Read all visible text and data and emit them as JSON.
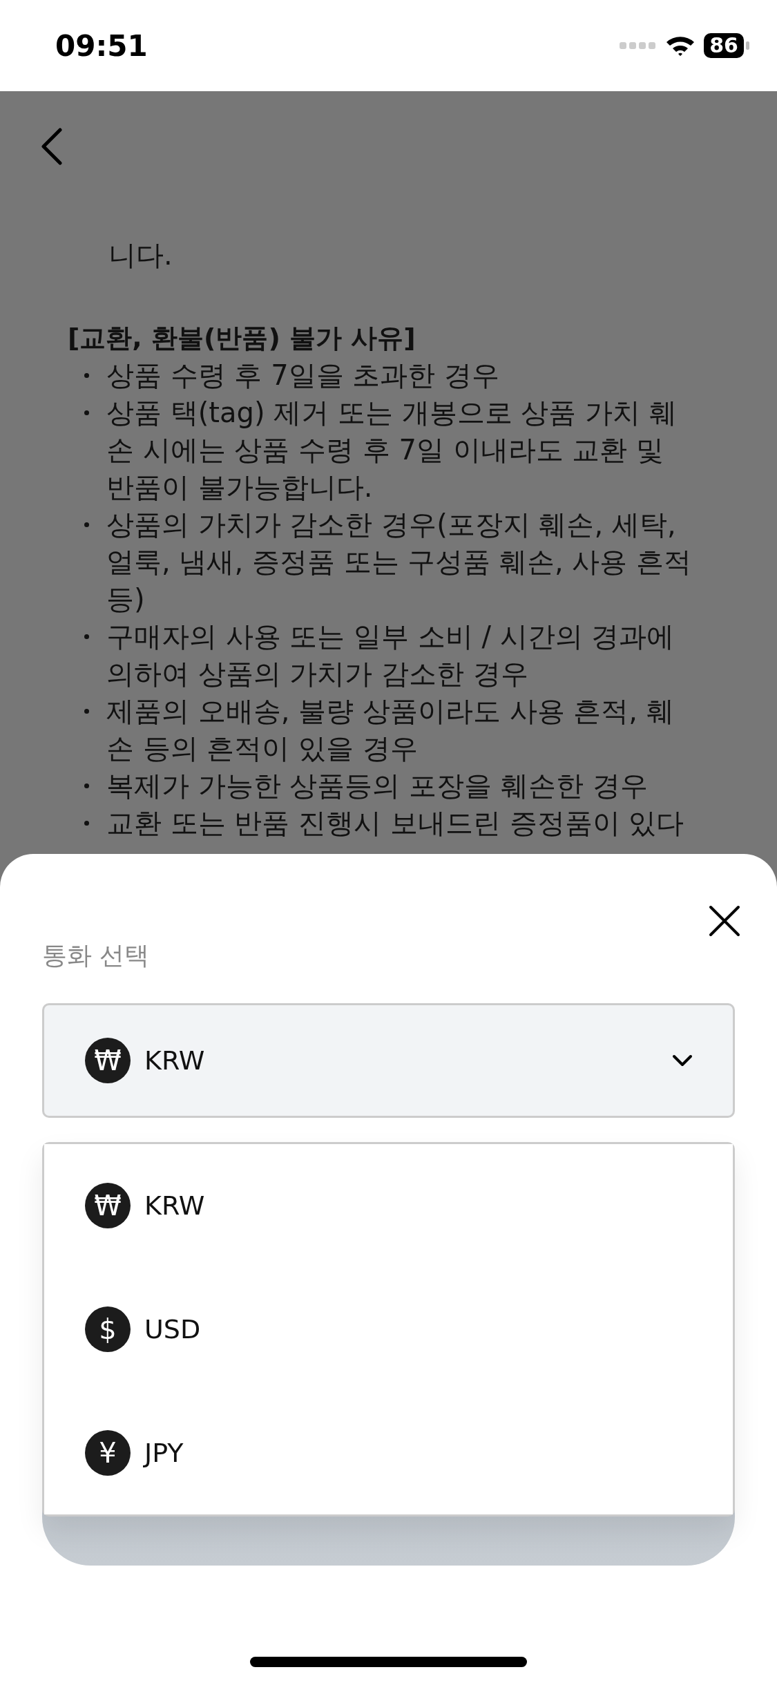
{
  "status_bar": {
    "time": "09:51",
    "battery": "86"
  },
  "page": {
    "intro_tail": "니다.",
    "heading": "[교환, 환불(반품) 불가 사유]",
    "bullets": [
      "상품 수령 후 7일을 초과한 경우",
      "상품 택(tag) 제거 또는 개봉으로 상품 가치 훼\n손 시에는 상품 수령 후 7일 이내라도 교환 및\n반품이 불가능합니다.",
      "상품의 가치가 감소한 경우(포장지 훼손, 세탁,\n얼룩, 냄새, 증정품 또는 구성품 훼손, 사용 흔적\n등)",
      "구매자의 사용 또는 일부 소비 / 시간의 경과에\n의하여 상품의 가치가 감소한 경우",
      "제품의 오배송, 불량 상품이라도 사용 흔적, 훼\n손 등의 흔적이 있을 경우",
      "복제가 가능한 상품등의 포장을 훼손한 경우",
      "교환 또는 반품 진행시 보내드린 증정품이 있다"
    ]
  },
  "sheet": {
    "label": "통화 선택",
    "select": {
      "symbol": "₩",
      "value": "KRW",
      "expanded": true
    },
    "options": [
      {
        "symbol": "₩",
        "code": "KRW"
      },
      {
        "symbol": "$",
        "code": "USD"
      },
      {
        "symbol": "¥",
        "code": "JPY"
      }
    ]
  }
}
